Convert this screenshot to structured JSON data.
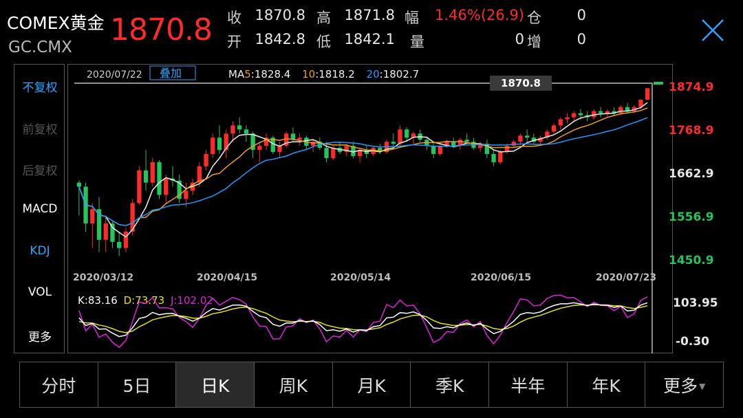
{
  "header": {
    "title": "COMEX黄金",
    "code": "GC.CMX",
    "price": "1870.8",
    "quote": [
      {
        "k": "收",
        "v": "1870.8"
      },
      {
        "k": "高",
        "v": "1871.8"
      },
      {
        "k": "幅",
        "v": "1.46%(26.9)"
      },
      {
        "k": "仓",
        "v": "0"
      },
      {
        "k": "开",
        "v": "1842.8"
      },
      {
        "k": "低",
        "v": "1842.1"
      },
      {
        "k": "量",
        "v": "0"
      },
      {
        "k": "增",
        "v": "0"
      }
    ]
  },
  "left_menu": [
    {
      "label": "不复权",
      "state": "active"
    },
    {
      "label": "前复权",
      "state": "disabled"
    },
    {
      "label": "后复权",
      "state": "disabled"
    },
    {
      "label": "MACD",
      "state": "normal"
    },
    {
      "label": "KDJ",
      "state": "active"
    },
    {
      "label": "VOL",
      "state": "normal"
    },
    {
      "label": "更多",
      "state": "normal"
    }
  ],
  "chart_data": {
    "type": "candlestick",
    "date_label": "2020/07/22",
    "overlay_button": "叠加",
    "ma": [
      {
        "name": "MA5",
        "label": "MA5",
        "value": "1828.4",
        "color": "#f0f0f0"
      },
      {
        "name": "MA10",
        "label": "10",
        "value": "1818.2",
        "color": "#f0a020"
      },
      {
        "name": "MA20",
        "label": "20",
        "value": "1802.7",
        "color": "#1e9bff"
      }
    ],
    "current_price_tag": "1870.8",
    "y_ticks": [
      {
        "value": 1874.9,
        "label": "1874.9",
        "color": "#ff2a2a"
      },
      {
        "value": 1768.9,
        "label": "1768.9",
        "color": "#ff2a2a"
      },
      {
        "value": 1662.9,
        "label": "1662.9",
        "color": "#e8e8e8"
      },
      {
        "value": 1556.9,
        "label": "1556.9",
        "color": "#22c55e"
      },
      {
        "value": 1450.9,
        "label": "1450.9",
        "color": "#22c55e"
      }
    ],
    "ylim": [
      1450.9,
      1874.9
    ],
    "x_ticks": [
      "2020/03/12",
      "2020/04/15",
      "2020/05/14",
      "2020/06/15",
      "2020/07/23"
    ],
    "candles": [
      [
        1640,
        1645,
        1560,
        1630
      ],
      [
        1630,
        1640,
        1520,
        1540
      ],
      [
        1540,
        1590,
        1480,
        1575
      ],
      [
        1575,
        1605,
        1470,
        1500
      ],
      [
        1500,
        1560,
        1470,
        1540
      ],
      [
        1540,
        1545,
        1480,
        1495
      ],
      [
        1495,
        1520,
        1460,
        1480
      ],
      [
        1480,
        1530,
        1470,
        1520
      ],
      [
        1520,
        1600,
        1510,
        1590
      ],
      [
        1590,
        1680,
        1585,
        1670
      ],
      [
        1670,
        1720,
        1620,
        1640
      ],
      [
        1640,
        1700,
        1630,
        1690
      ],
      [
        1690,
        1695,
        1600,
        1610
      ],
      [
        1610,
        1660,
        1590,
        1650
      ],
      [
        1650,
        1680,
        1630,
        1645
      ],
      [
        1645,
        1660,
        1590,
        1600
      ],
      [
        1600,
        1640,
        1580,
        1620
      ],
      [
        1620,
        1650,
        1610,
        1640
      ],
      [
        1640,
        1690,
        1630,
        1680
      ],
      [
        1680,
        1720,
        1670,
        1710
      ],
      [
        1710,
        1760,
        1700,
        1750
      ],
      [
        1750,
        1780,
        1710,
        1720
      ],
      [
        1720,
        1770,
        1700,
        1760
      ],
      [
        1760,
        1790,
        1740,
        1780
      ],
      [
        1780,
        1800,
        1760,
        1770
      ],
      [
        1770,
        1780,
        1740,
        1760
      ],
      [
        1760,
        1765,
        1700,
        1720
      ],
      [
        1720,
        1740,
        1690,
        1730
      ],
      [
        1730,
        1760,
        1720,
        1750
      ],
      [
        1750,
        1755,
        1710,
        1715
      ],
      [
        1715,
        1740,
        1700,
        1730
      ],
      [
        1730,
        1765,
        1725,
        1760
      ],
      [
        1760,
        1775,
        1740,
        1745
      ],
      [
        1745,
        1760,
        1730,
        1750
      ],
      [
        1750,
        1755,
        1720,
        1730
      ],
      [
        1730,
        1745,
        1715,
        1740
      ],
      [
        1740,
        1750,
        1720,
        1725
      ],
      [
        1725,
        1740,
        1690,
        1700
      ],
      [
        1700,
        1730,
        1695,
        1725
      ],
      [
        1725,
        1740,
        1710,
        1715
      ],
      [
        1715,
        1735,
        1705,
        1730
      ],
      [
        1730,
        1740,
        1700,
        1705
      ],
      [
        1705,
        1725,
        1690,
        1720
      ],
      [
        1720,
        1730,
        1700,
        1710
      ],
      [
        1710,
        1730,
        1705,
        1725
      ],
      [
        1725,
        1735,
        1710,
        1715
      ],
      [
        1715,
        1745,
        1710,
        1740
      ],
      [
        1740,
        1760,
        1730,
        1735
      ],
      [
        1735,
        1780,
        1730,
        1770
      ],
      [
        1770,
        1775,
        1740,
        1750
      ],
      [
        1750,
        1765,
        1735,
        1760
      ],
      [
        1760,
        1770,
        1740,
        1745
      ],
      [
        1745,
        1750,
        1720,
        1730
      ],
      [
        1730,
        1740,
        1700,
        1710
      ],
      [
        1710,
        1735,
        1705,
        1730
      ],
      [
        1730,
        1745,
        1725,
        1740
      ],
      [
        1740,
        1750,
        1725,
        1730
      ],
      [
        1730,
        1750,
        1720,
        1745
      ],
      [
        1745,
        1760,
        1735,
        1740
      ],
      [
        1740,
        1750,
        1720,
        1725
      ],
      [
        1725,
        1740,
        1715,
        1735
      ],
      [
        1735,
        1745,
        1700,
        1710
      ],
      [
        1710,
        1720,
        1680,
        1690
      ],
      [
        1690,
        1720,
        1685,
        1715
      ],
      [
        1715,
        1735,
        1710,
        1730
      ],
      [
        1730,
        1745,
        1725,
        1740
      ],
      [
        1740,
        1760,
        1735,
        1755
      ],
      [
        1755,
        1770,
        1740,
        1750
      ],
      [
        1750,
        1760,
        1735,
        1740
      ],
      [
        1740,
        1755,
        1730,
        1750
      ],
      [
        1750,
        1770,
        1745,
        1765
      ],
      [
        1765,
        1785,
        1760,
        1780
      ],
      [
        1780,
        1800,
        1770,
        1795
      ],
      [
        1795,
        1810,
        1785,
        1800
      ],
      [
        1800,
        1815,
        1790,
        1810
      ],
      [
        1810,
        1820,
        1795,
        1805
      ],
      [
        1805,
        1815,
        1790,
        1800
      ],
      [
        1800,
        1820,
        1795,
        1815
      ],
      [
        1815,
        1825,
        1800,
        1810
      ],
      [
        1810,
        1820,
        1800,
        1815
      ],
      [
        1815,
        1825,
        1805,
        1810
      ],
      [
        1810,
        1830,
        1805,
        1825
      ],
      [
        1825,
        1835,
        1810,
        1815
      ],
      [
        1815,
        1830,
        1810,
        1825
      ],
      [
        1825,
        1840,
        1820,
        1843
      ],
      [
        1843,
        1872,
        1842,
        1871
      ]
    ],
    "kdj": {
      "label_k": "K:83.16",
      "label_d": "D:73.73",
      "label_j": "J:102.02",
      "y_ticks": [
        "103.95",
        "-0.30"
      ],
      "ylim": [
        -0.3,
        103.95
      ]
    }
  },
  "tabs": [
    {
      "label": "分时",
      "active": false
    },
    {
      "label": "5日",
      "active": false
    },
    {
      "label": "日K",
      "active": true
    },
    {
      "label": "周K",
      "active": false
    },
    {
      "label": "月K",
      "active": false
    },
    {
      "label": "季K",
      "active": false
    },
    {
      "label": "半年",
      "active": false
    },
    {
      "label": "年K",
      "active": false
    },
    {
      "label": "更多",
      "active": false
    }
  ],
  "colors": {
    "up": "#ff2a2a",
    "down": "#22c55e",
    "k": "#ffffff",
    "d": "#e6e600",
    "j": "#e020e0"
  }
}
